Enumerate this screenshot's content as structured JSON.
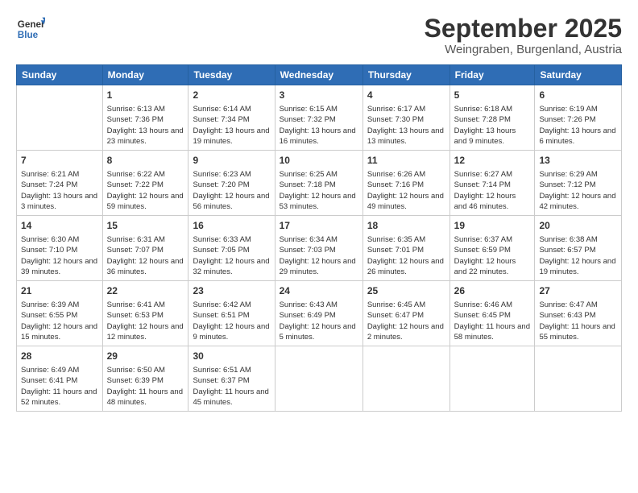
{
  "logo": {
    "line1": "General",
    "line2": "Blue"
  },
  "title": "September 2025",
  "subtitle": "Weingraben, Burgenland, Austria",
  "headers": [
    "Sunday",
    "Monday",
    "Tuesday",
    "Wednesday",
    "Thursday",
    "Friday",
    "Saturday"
  ],
  "weeks": [
    [
      {
        "day": "",
        "sunrise": "",
        "sunset": "",
        "daylight": ""
      },
      {
        "day": "1",
        "sunrise": "Sunrise: 6:13 AM",
        "sunset": "Sunset: 7:36 PM",
        "daylight": "Daylight: 13 hours and 23 minutes."
      },
      {
        "day": "2",
        "sunrise": "Sunrise: 6:14 AM",
        "sunset": "Sunset: 7:34 PM",
        "daylight": "Daylight: 13 hours and 19 minutes."
      },
      {
        "day": "3",
        "sunrise": "Sunrise: 6:15 AM",
        "sunset": "Sunset: 7:32 PM",
        "daylight": "Daylight: 13 hours and 16 minutes."
      },
      {
        "day": "4",
        "sunrise": "Sunrise: 6:17 AM",
        "sunset": "Sunset: 7:30 PM",
        "daylight": "Daylight: 13 hours and 13 minutes."
      },
      {
        "day": "5",
        "sunrise": "Sunrise: 6:18 AM",
        "sunset": "Sunset: 7:28 PM",
        "daylight": "Daylight: 13 hours and 9 minutes."
      },
      {
        "day": "6",
        "sunrise": "Sunrise: 6:19 AM",
        "sunset": "Sunset: 7:26 PM",
        "daylight": "Daylight: 13 hours and 6 minutes."
      }
    ],
    [
      {
        "day": "7",
        "sunrise": "Sunrise: 6:21 AM",
        "sunset": "Sunset: 7:24 PM",
        "daylight": "Daylight: 13 hours and 3 minutes."
      },
      {
        "day": "8",
        "sunrise": "Sunrise: 6:22 AM",
        "sunset": "Sunset: 7:22 PM",
        "daylight": "Daylight: 12 hours and 59 minutes."
      },
      {
        "day": "9",
        "sunrise": "Sunrise: 6:23 AM",
        "sunset": "Sunset: 7:20 PM",
        "daylight": "Daylight: 12 hours and 56 minutes."
      },
      {
        "day": "10",
        "sunrise": "Sunrise: 6:25 AM",
        "sunset": "Sunset: 7:18 PM",
        "daylight": "Daylight: 12 hours and 53 minutes."
      },
      {
        "day": "11",
        "sunrise": "Sunrise: 6:26 AM",
        "sunset": "Sunset: 7:16 PM",
        "daylight": "Daylight: 12 hours and 49 minutes."
      },
      {
        "day": "12",
        "sunrise": "Sunrise: 6:27 AM",
        "sunset": "Sunset: 7:14 PM",
        "daylight": "Daylight: 12 hours and 46 minutes."
      },
      {
        "day": "13",
        "sunrise": "Sunrise: 6:29 AM",
        "sunset": "Sunset: 7:12 PM",
        "daylight": "Daylight: 12 hours and 42 minutes."
      }
    ],
    [
      {
        "day": "14",
        "sunrise": "Sunrise: 6:30 AM",
        "sunset": "Sunset: 7:10 PM",
        "daylight": "Daylight: 12 hours and 39 minutes."
      },
      {
        "day": "15",
        "sunrise": "Sunrise: 6:31 AM",
        "sunset": "Sunset: 7:07 PM",
        "daylight": "Daylight: 12 hours and 36 minutes."
      },
      {
        "day": "16",
        "sunrise": "Sunrise: 6:33 AM",
        "sunset": "Sunset: 7:05 PM",
        "daylight": "Daylight: 12 hours and 32 minutes."
      },
      {
        "day": "17",
        "sunrise": "Sunrise: 6:34 AM",
        "sunset": "Sunset: 7:03 PM",
        "daylight": "Daylight: 12 hours and 29 minutes."
      },
      {
        "day": "18",
        "sunrise": "Sunrise: 6:35 AM",
        "sunset": "Sunset: 7:01 PM",
        "daylight": "Daylight: 12 hours and 26 minutes."
      },
      {
        "day": "19",
        "sunrise": "Sunrise: 6:37 AM",
        "sunset": "Sunset: 6:59 PM",
        "daylight": "Daylight: 12 hours and 22 minutes."
      },
      {
        "day": "20",
        "sunrise": "Sunrise: 6:38 AM",
        "sunset": "Sunset: 6:57 PM",
        "daylight": "Daylight: 12 hours and 19 minutes."
      }
    ],
    [
      {
        "day": "21",
        "sunrise": "Sunrise: 6:39 AM",
        "sunset": "Sunset: 6:55 PM",
        "daylight": "Daylight: 12 hours and 15 minutes."
      },
      {
        "day": "22",
        "sunrise": "Sunrise: 6:41 AM",
        "sunset": "Sunset: 6:53 PM",
        "daylight": "Daylight: 12 hours and 12 minutes."
      },
      {
        "day": "23",
        "sunrise": "Sunrise: 6:42 AM",
        "sunset": "Sunset: 6:51 PM",
        "daylight": "Daylight: 12 hours and 9 minutes."
      },
      {
        "day": "24",
        "sunrise": "Sunrise: 6:43 AM",
        "sunset": "Sunset: 6:49 PM",
        "daylight": "Daylight: 12 hours and 5 minutes."
      },
      {
        "day": "25",
        "sunrise": "Sunrise: 6:45 AM",
        "sunset": "Sunset: 6:47 PM",
        "daylight": "Daylight: 12 hours and 2 minutes."
      },
      {
        "day": "26",
        "sunrise": "Sunrise: 6:46 AM",
        "sunset": "Sunset: 6:45 PM",
        "daylight": "Daylight: 11 hours and 58 minutes."
      },
      {
        "day": "27",
        "sunrise": "Sunrise: 6:47 AM",
        "sunset": "Sunset: 6:43 PM",
        "daylight": "Daylight: 11 hours and 55 minutes."
      }
    ],
    [
      {
        "day": "28",
        "sunrise": "Sunrise: 6:49 AM",
        "sunset": "Sunset: 6:41 PM",
        "daylight": "Daylight: 11 hours and 52 minutes."
      },
      {
        "day": "29",
        "sunrise": "Sunrise: 6:50 AM",
        "sunset": "Sunset: 6:39 PM",
        "daylight": "Daylight: 11 hours and 48 minutes."
      },
      {
        "day": "30",
        "sunrise": "Sunrise: 6:51 AM",
        "sunset": "Sunset: 6:37 PM",
        "daylight": "Daylight: 11 hours and 45 minutes."
      },
      {
        "day": "",
        "sunrise": "",
        "sunset": "",
        "daylight": ""
      },
      {
        "day": "",
        "sunrise": "",
        "sunset": "",
        "daylight": ""
      },
      {
        "day": "",
        "sunrise": "",
        "sunset": "",
        "daylight": ""
      },
      {
        "day": "",
        "sunrise": "",
        "sunset": "",
        "daylight": ""
      }
    ]
  ]
}
